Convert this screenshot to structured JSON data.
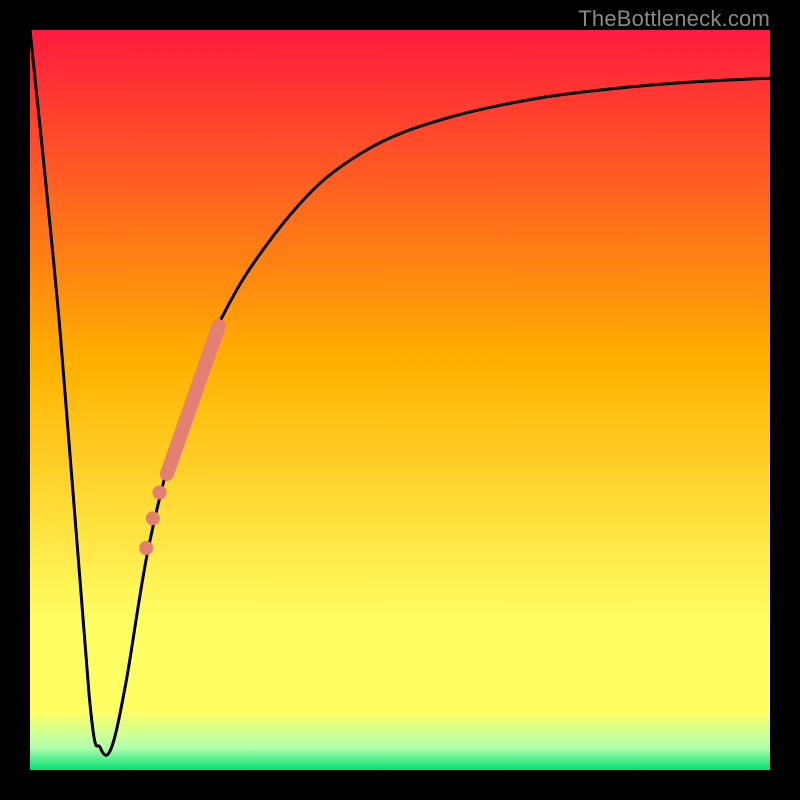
{
  "watermark": "TheBottleneck.com",
  "colors": {
    "frame": "#000000",
    "curve": "#000000",
    "markers": "#e37f73",
    "grad_top": "#ff1a3e",
    "grad_mid": "#ffb000",
    "grad_yellow": "#ffff64",
    "grad_green_light": "#b0ffb0",
    "grad_green": "#00e070"
  },
  "chart_data": {
    "type": "line",
    "title": "",
    "xlabel": "",
    "ylabel": "",
    "xlim": [
      0,
      100
    ],
    "ylim": [
      0,
      100
    ],
    "series": [
      {
        "name": "bottleneck-curve",
        "x": [
          0,
          4,
          8,
          9.5,
          11,
          13,
          16,
          20,
          24,
          28,
          32,
          36,
          40,
          45,
          50,
          56,
          62,
          70,
          80,
          90,
          100
        ],
        "values": [
          100,
          60,
          10,
          3,
          3,
          12,
          30,
          46,
          57,
          65,
          71,
          76,
          80,
          83.5,
          86,
          88,
          89.5,
          91,
          92.2,
          93,
          93.5
        ]
      }
    ],
    "markers": {
      "name": "highlighted-range",
      "segment": {
        "x1": 18.5,
        "y1": 40,
        "x2": 25.5,
        "y2": 60
      },
      "dots": [
        {
          "x": 17.5,
          "y": 37.5
        },
        {
          "x": 16.6,
          "y": 34
        },
        {
          "x": 15.7,
          "y": 30
        }
      ]
    }
  }
}
